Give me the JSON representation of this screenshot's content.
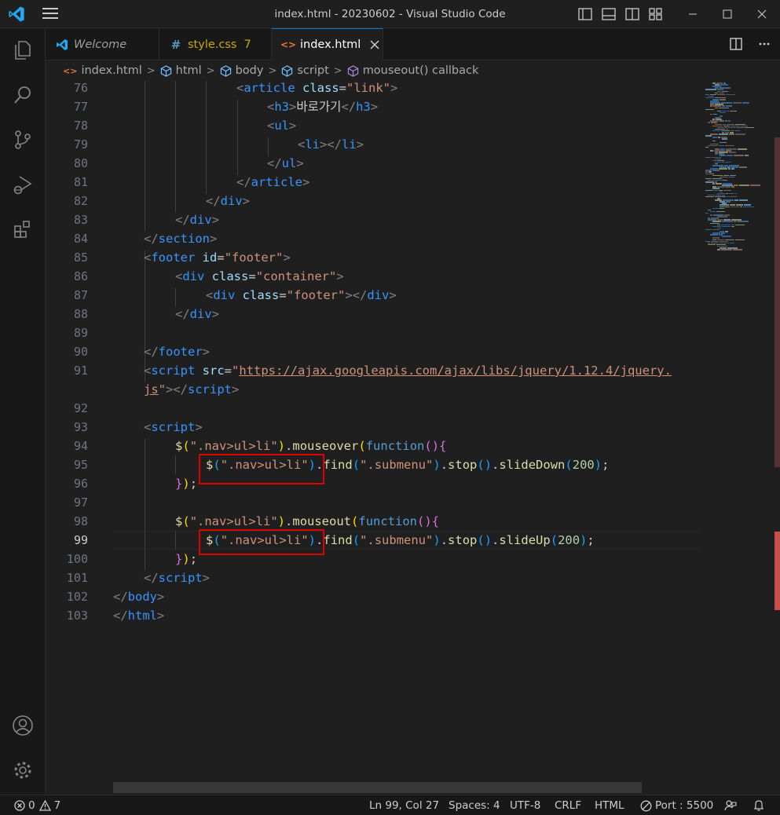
{
  "window": {
    "title": "index.html - 20230602 - Visual Studio Code"
  },
  "tabs": [
    {
      "label": "Welcome",
      "modified": ""
    },
    {
      "label": "style.css",
      "modified": "7"
    },
    {
      "label": "index.html",
      "modified": ""
    }
  ],
  "breadcrumb": [
    "index.html",
    "html",
    "body",
    "script",
    "mouseout() callback"
  ],
  "editor": {
    "current_line": "99",
    "line_numbers": [
      "76",
      "77",
      "78",
      "79",
      "80",
      "81",
      "82",
      "83",
      "84",
      "85",
      "86",
      "87",
      "88",
      "89",
      "90",
      "91",
      "",
      "92",
      "93",
      "94",
      "95",
      "96",
      "97",
      "98",
      "99",
      "100",
      "101",
      "102",
      "103"
    ],
    "code": {
      "l76": [
        "<",
        "article",
        " class",
        "=",
        "\"link\"",
        ">"
      ],
      "l77": [
        "<",
        "h3",
        ">",
        "바로가기",
        "</",
        "h3",
        ">"
      ],
      "l78": [
        "<",
        "ul",
        ">"
      ],
      "l79": [
        "<",
        "li",
        "></",
        "li",
        ">"
      ],
      "l80": [
        "</",
        "ul",
        ">"
      ],
      "l81": [
        "</",
        "article",
        ">"
      ],
      "l82": [
        "</",
        "div",
        ">"
      ],
      "l83": [
        "</",
        "div",
        ">"
      ],
      "l84": [
        "</",
        "section",
        ">"
      ],
      "l85": [
        "<",
        "footer",
        " id",
        "=",
        "\"footer\"",
        ">"
      ],
      "l86": [
        "<",
        "div",
        " class",
        "=",
        "\"container\"",
        ">"
      ],
      "l87": [
        "<",
        "div",
        " class",
        "=",
        "\"footer\"",
        "></",
        "div",
        ">"
      ],
      "l88": [
        "</",
        "div",
        ">"
      ],
      "l90": [
        "</",
        "footer",
        ">"
      ],
      "l91a": [
        "<",
        "script",
        " src",
        "=",
        "\"",
        "https://ajax.googleapis.com/ajax/libs/jquery/1.12.4/jquery."
      ],
      "l91b": [
        "js",
        "\"",
        "></",
        "script",
        ">"
      ],
      "l93": [
        "<",
        "script",
        ">"
      ],
      "l94": [
        "$",
        "(",
        "\".nav>ul>li\"",
        ")",
        ".",
        "mouseover",
        "(",
        "function",
        "()",
        "{"
      ],
      "l95": [
        "$",
        "(",
        "\".nav>ul>li\"",
        ")",
        ".",
        "find",
        "(",
        "\".submenu\"",
        ")",
        ".",
        "stop",
        "()",
        ".",
        "slideDown",
        "(",
        "200",
        ")",
        ";"
      ],
      "l96": [
        "}",
        ")",
        ";"
      ],
      "l98": [
        "$",
        "(",
        "\".nav>ul>li\"",
        ")",
        ".",
        "mouseout",
        "(",
        "function",
        "()",
        "{"
      ],
      "l99": [
        "$",
        "(",
        "\".nav>ul>li\"",
        ")",
        ".",
        "find",
        "(",
        "\".submenu\"",
        ")",
        ".",
        "stop",
        "()",
        ".",
        "slideUp",
        "(",
        "200",
        ")",
        ";"
      ],
      "l100": [
        "}",
        ")",
        ";"
      ],
      "l101": [
        "</",
        "script",
        ">"
      ],
      "l102": [
        "</",
        "body",
        ">"
      ],
      "l103": [
        "</",
        "html",
        ">"
      ]
    }
  },
  "statusbar": {
    "errors": "0",
    "warnings": "7",
    "position": "Ln 99, Col 27",
    "spaces": "Spaces: 4",
    "encoding": "UTF-8",
    "eol": "CRLF",
    "language": "HTML",
    "port": "Port : 5500"
  },
  "colors": {
    "accent": "#0078d4",
    "highlight_box": "#e00000",
    "vscode_logo": "#23a9f2"
  }
}
